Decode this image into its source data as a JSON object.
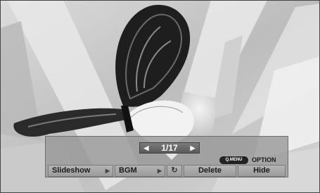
{
  "counter": {
    "text": "1/17"
  },
  "qmenu": {
    "label": "Q.MENU"
  },
  "option": {
    "label": "OPTION"
  },
  "buttons": {
    "slideshow": "Slideshow",
    "bgm": "BGM",
    "rotate_icon": "rotate-icon",
    "delete": "Delete",
    "hide": "Hide"
  },
  "colors": {
    "panel": "#9a9a9a",
    "counter": "#666666",
    "qmenu": "#222222"
  }
}
